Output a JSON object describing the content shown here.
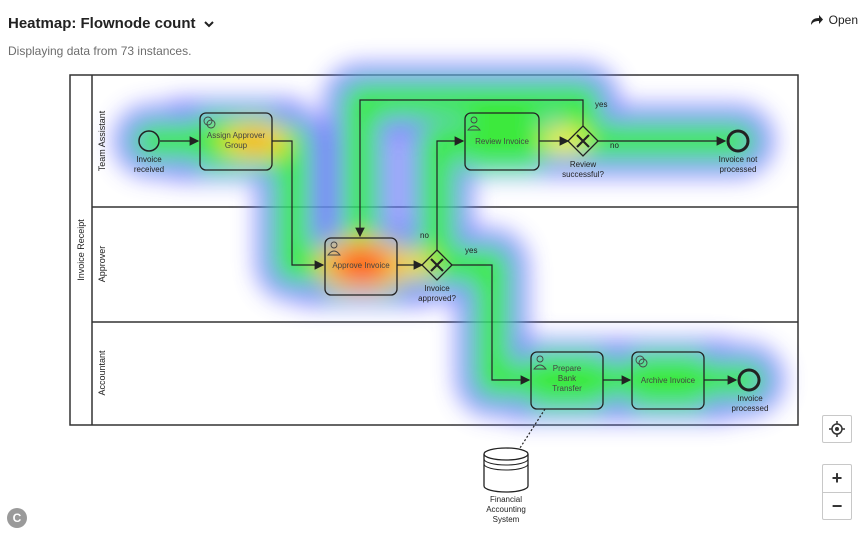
{
  "header": {
    "title": "Heatmap: Flownode count",
    "subtitle": "Displaying data from 73 instances.",
    "open_label": "Open"
  },
  "diagram": {
    "pool_label": "Invoice Receipt",
    "lanes": [
      "Team Assistant",
      "Approver",
      "Accountant"
    ],
    "nodes": {
      "start_event": "Invoice received",
      "assign_approver": "Assign Approver Group",
      "review_invoice": "Review Invoice",
      "review_gateway": "Review successful?",
      "end_not_processed": "Invoice not processed",
      "approve_invoice": "Approve Invoice",
      "approval_gateway": "Invoice approved?",
      "prepare_bank_transfer": "Prepare Bank Transfer",
      "archive_invoice": "Archive Invoice",
      "end_processed": "Invoice processed",
      "data_store": "Financial Accounting System"
    },
    "flow_labels": {
      "review_yes": "yes",
      "review_no": "no",
      "approved_no": "no",
      "approved_yes": "yes"
    }
  },
  "controls": {
    "recenter_icon": "crosshair-icon",
    "zoom_in": "+",
    "zoom_out": "−"
  },
  "brand": {
    "logo_letter": "C"
  },
  "colors": {
    "heat_low": "#5a5aff",
    "heat_mid": "#22e622",
    "heat_high": "#ff2a00"
  }
}
